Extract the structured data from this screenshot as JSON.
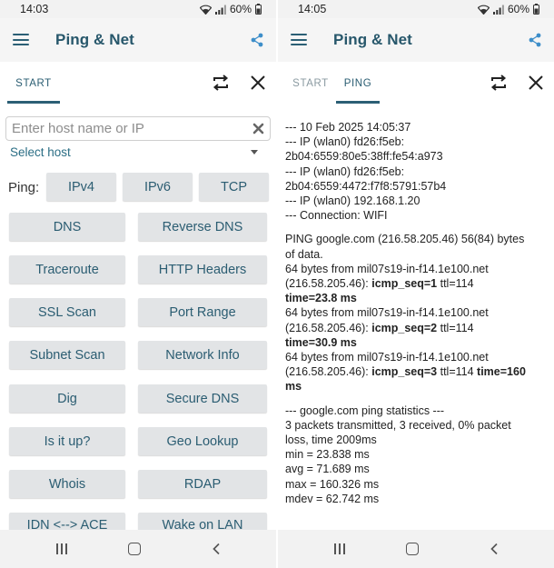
{
  "left": {
    "status": {
      "time": "14:03",
      "battery": "60%"
    },
    "app_title": "Ping & Net",
    "tabs": [
      {
        "label": "START",
        "active": true
      }
    ],
    "host_placeholder": "Enter host name or IP",
    "select_host": "Select host",
    "ping_label": "Ping:",
    "ping_buttons": [
      "IPv4",
      "IPv6",
      "TCP"
    ],
    "tool_buttons": [
      [
        "DNS",
        "Reverse DNS"
      ],
      [
        "Traceroute",
        "HTTP Headers"
      ],
      [
        "SSL Scan",
        "Port Range"
      ],
      [
        "Subnet Scan",
        "Network Info"
      ],
      [
        "Dig",
        "Secure DNS"
      ],
      [
        "Is it up?",
        "Geo Lookup"
      ],
      [
        "Whois",
        "RDAP"
      ],
      [
        "IDN <--> ACE",
        "Wake on LAN"
      ]
    ]
  },
  "right": {
    "status": {
      "time": "14:05",
      "battery": "60%"
    },
    "app_title": "Ping & Net",
    "tabs": [
      {
        "label": "START",
        "active": false
      },
      {
        "label": "PING",
        "active": true
      }
    ],
    "header_lines": [
      "--- 10 Feb 2025 14:05:37",
      "--- IP (wlan0) fd26:f5eb:",
      "2b04:6559:80e5:38ff:fe54:a973",
      "--- IP (wlan0) fd26:f5eb:",
      "2b04:6559:4472:f7f8:5791:57b4",
      "--- IP (wlan0) 192.168.1.20",
      "--- Connection: WIFI"
    ],
    "ping_intro_1": "PING google.com (216.58.205.46) 56(84) bytes",
    "ping_intro_2": "of data.",
    "replies": [
      {
        "l1": "64 bytes from mil07s19-in-f14.1e100.net",
        "l2a": "(216.58.205.46): ",
        "seq": "icmp_seq=1",
        "ttl": " ttl=114",
        "time_tail": "",
        "time_line": "time=23.8 ms"
      },
      {
        "l1": "64 bytes from mil07s19-in-f14.1e100.net",
        "l2a": "(216.58.205.46): ",
        "seq": "icmp_seq=2",
        "ttl": " ttl=114",
        "time_tail": "",
        "time_line": "time=30.9 ms"
      },
      {
        "l1": "64 bytes from mil07s19-in-f14.1e100.net",
        "l2a": "(216.58.205.46): ",
        "seq": "icmp_seq=3",
        "ttl": " ttl=114 ",
        "time_tail": "time=160",
        "time_line": "ms"
      }
    ],
    "stats_lines": [
      "--- google.com ping statistics ---",
      "3 packets transmitted, 3 received, 0% packet",
      "loss, time 2009ms",
      "min = 23.838 ms",
      "avg = 71.689 ms",
      "max = 160.326 ms",
      "mdev = 62.742 ms"
    ]
  },
  "colors": {
    "accent": "#2b5f75",
    "button_bg": "#e2e4e6",
    "link": "#2b6e85"
  },
  "icons": [
    "menu-icon",
    "share-icon",
    "repeat-icon",
    "close-icon",
    "clear-icon",
    "wifi-icon",
    "signal-icon",
    "battery-icon",
    "nav-recents-icon",
    "nav-home-icon",
    "nav-back-icon"
  ]
}
